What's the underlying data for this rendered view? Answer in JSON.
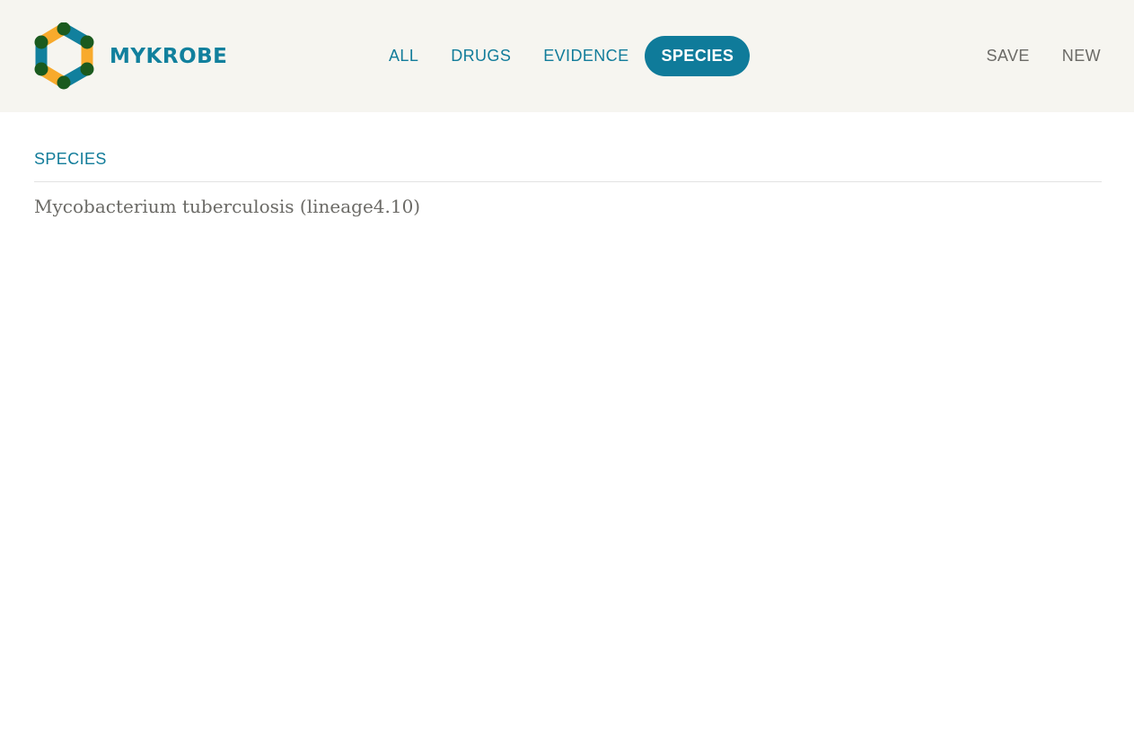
{
  "brand": {
    "name": "MYKROBE",
    "colors": {
      "teal": "#11809d",
      "orange": "#f8aa2c",
      "dark_green": "#1a5a1e"
    }
  },
  "nav": {
    "tabs": [
      {
        "label": "ALL",
        "active": false
      },
      {
        "label": "DRUGS",
        "active": false
      },
      {
        "label": "EVIDENCE",
        "active": false
      },
      {
        "label": "SPECIES",
        "active": true
      }
    ],
    "active_color": "#0f7b9a"
  },
  "actions": {
    "save_label": "SAVE",
    "new_label": "NEW"
  },
  "main": {
    "section_title": "SPECIES",
    "species": "Mycobacterium tuberculosis (lineage4.10)"
  }
}
